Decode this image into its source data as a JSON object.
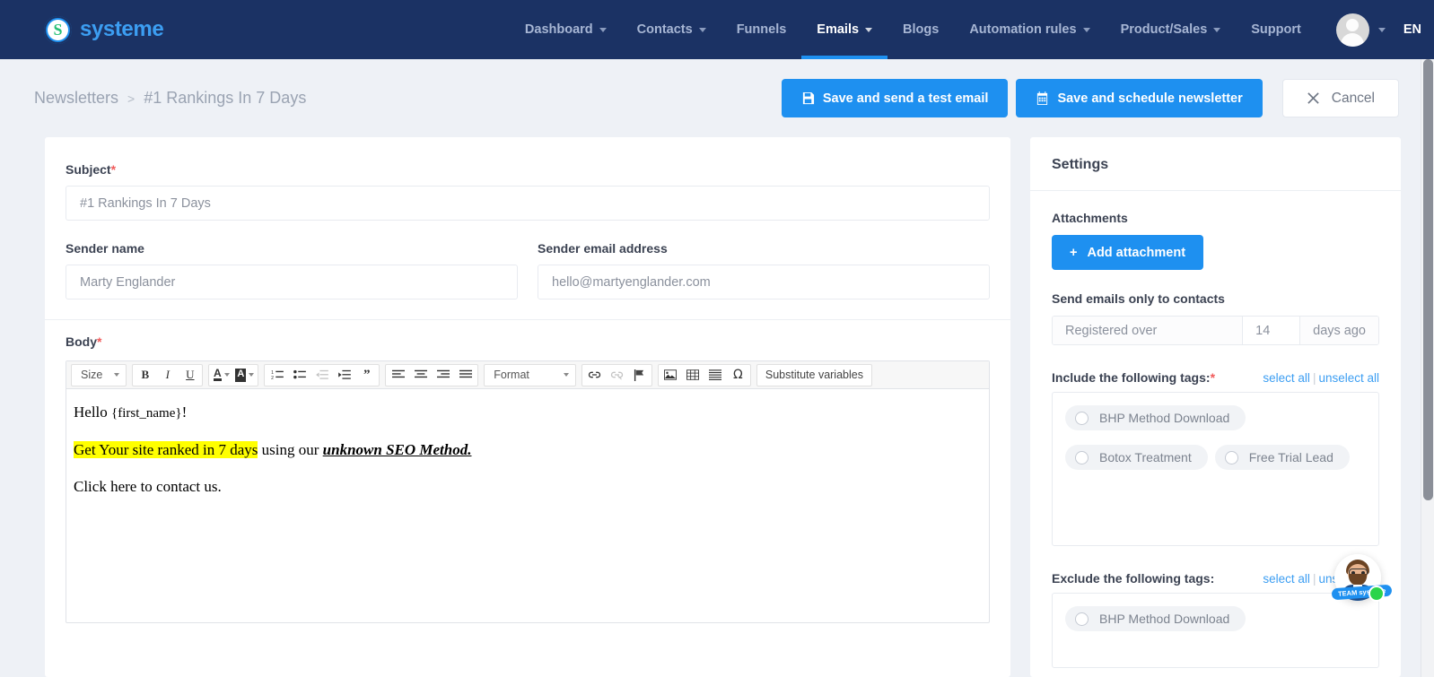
{
  "nav": {
    "brand": "systeme",
    "items": [
      {
        "label": "Dashboard",
        "has_caret": true,
        "active": false
      },
      {
        "label": "Contacts",
        "has_caret": true,
        "active": false
      },
      {
        "label": "Funnels",
        "has_caret": false,
        "active": false
      },
      {
        "label": "Emails",
        "has_caret": true,
        "active": true
      },
      {
        "label": "Blogs",
        "has_caret": false,
        "active": false
      },
      {
        "label": "Automation rules",
        "has_caret": true,
        "active": false
      },
      {
        "label": "Product/Sales",
        "has_caret": true,
        "active": false
      },
      {
        "label": "Support",
        "has_caret": false,
        "active": false
      }
    ],
    "language": "EN",
    "accent_color": "#1e90f0",
    "bar_color": "#1b3264"
  },
  "subheader": {
    "breadcrumb_parent": "Newsletters",
    "breadcrumb_separator": ">",
    "breadcrumb_current": "#1 Rankings In 7 Days",
    "save_test_label": "Save and send a test email",
    "save_schedule_label": "Save and schedule newsletter",
    "cancel_label": "Cancel"
  },
  "form": {
    "subject_label": "Subject",
    "subject_value": "#1 Rankings In 7 Days",
    "sender_name_label": "Sender name",
    "sender_name_value": "Marty Englander",
    "sender_email_label": "Sender email address",
    "sender_email_value": "hello@martyenglander.com",
    "body_label": "Body",
    "required_marker": "*"
  },
  "editor": {
    "size_label": "Size",
    "format_label": "Format",
    "substitute_label": "Substitute variables",
    "buttons": [
      "bold",
      "italic",
      "underline",
      "text-color",
      "background-color",
      "numbered-list",
      "bulleted-list",
      "outdent",
      "indent",
      "blockquote",
      "align-left",
      "align-center",
      "align-right",
      "align-justify",
      "insert-link",
      "unlink",
      "anchor",
      "insert-image",
      "insert-table",
      "horizontal-rule",
      "special-character"
    ],
    "content": {
      "line1_a": "Hello ",
      "line1_b": "{first_name}",
      "line1_c": "!",
      "line2_highlight": "Get Your site ranked in 7 days",
      "line2_mid": " using our ",
      "line2_emph": "unknown SEO Method.",
      "line3": "Click here to contact us."
    }
  },
  "settings": {
    "title": "Settings",
    "attachments_label": "Attachments",
    "add_attachment_label": "Add attachment",
    "send_only_label": "Send emails only to contacts",
    "registered_over_label": "Registered over",
    "registered_days_value": "14",
    "days_ago_label": "days ago",
    "include_tags_label": "Include the following tags:",
    "exclude_tags_label": "Exclude the following tags:",
    "select_all_label": "select all",
    "links_separator": "|",
    "unselect_all_label": "unselect all",
    "include_tags": [
      {
        "label": "BHP Method Download",
        "selected": false
      },
      {
        "label": "Botox Treatment",
        "selected": false
      },
      {
        "label": "Free Trial Lead",
        "selected": false
      }
    ],
    "exclude_tags": [
      {
        "label": "BHP Method Download",
        "selected": false
      }
    ]
  },
  "chat": {
    "badge_label": "TEAM systeme",
    "status_color": "#2bd44a"
  }
}
